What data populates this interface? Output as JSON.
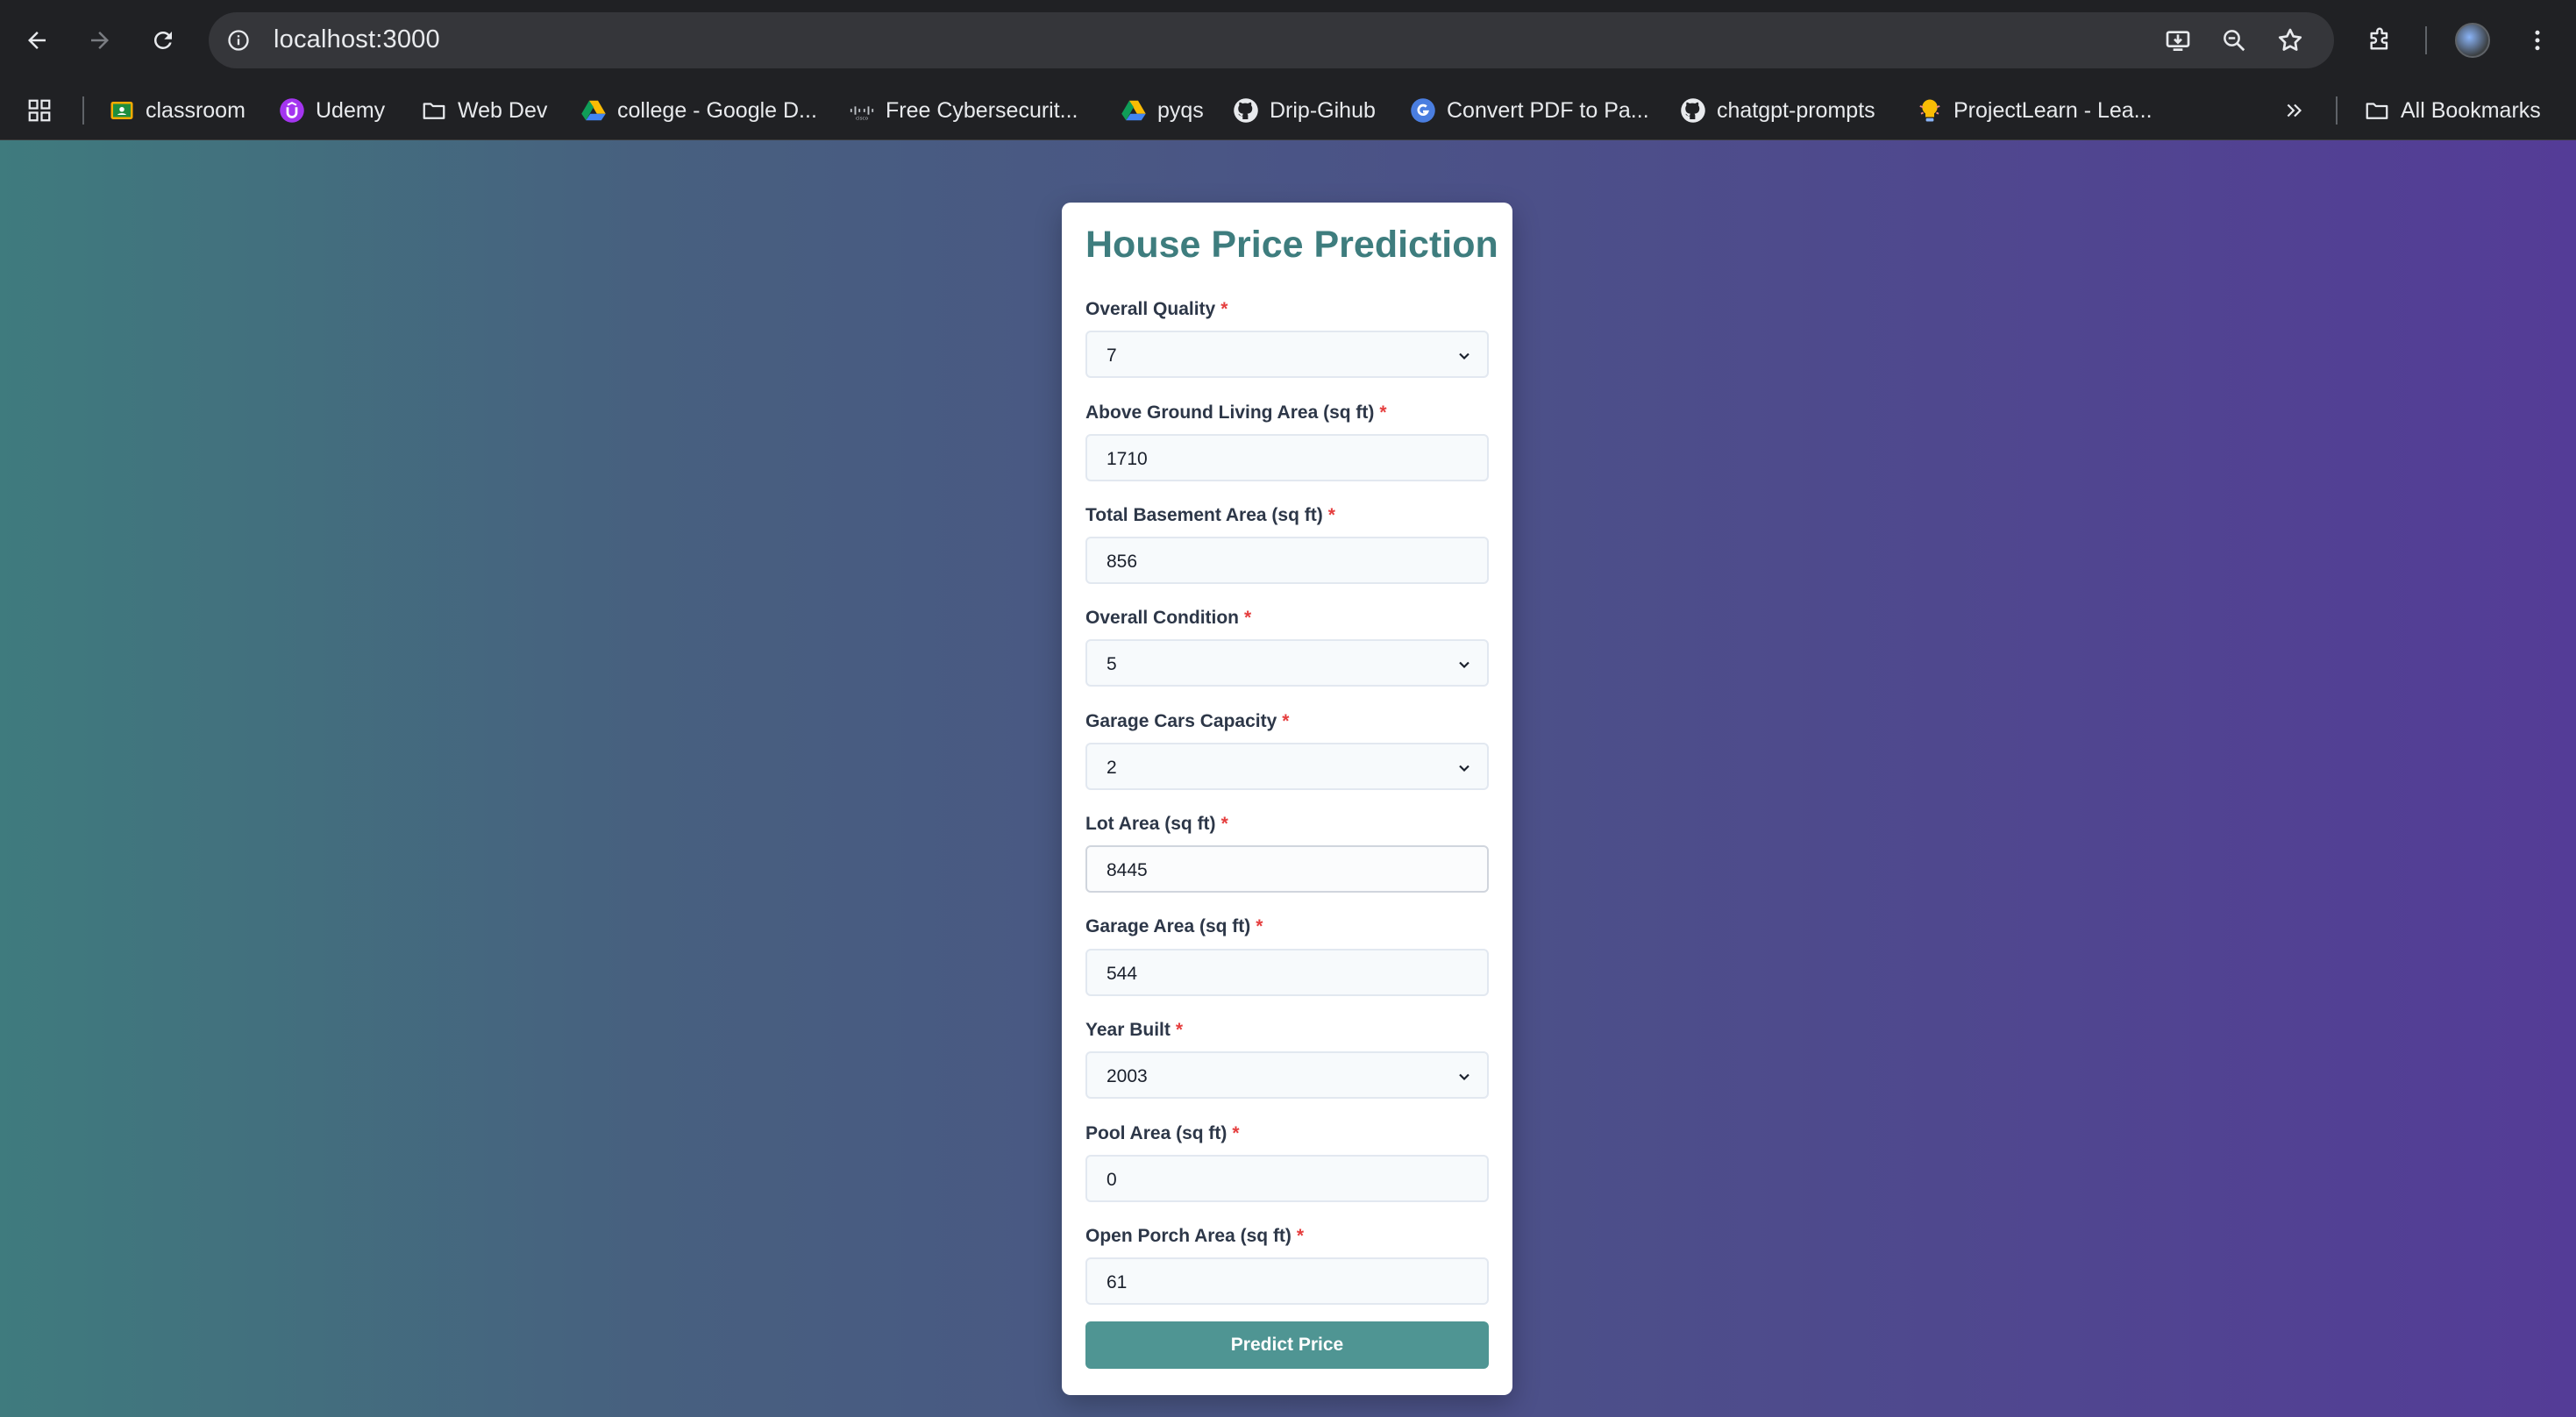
{
  "browser": {
    "url": "localhost:3000",
    "bookmarks": [
      {
        "label": "classroom",
        "icon": "classroom-icon"
      },
      {
        "label": "Udemy",
        "icon": "udemy-icon"
      },
      {
        "label": "Web Dev",
        "icon": "folder-icon"
      },
      {
        "label": "college - Google D...",
        "icon": "google-drive-icon"
      },
      {
        "label": "Free Cybersecurit...",
        "icon": "cisco-icon"
      },
      {
        "label": "pyqs",
        "icon": "google-drive-icon"
      },
      {
        "label": "Drip-Gihub",
        "icon": "github-icon"
      },
      {
        "label": "Convert PDF to Pa...",
        "icon": "convert-icon"
      },
      {
        "label": "chatgpt-prompts",
        "icon": "github-icon"
      },
      {
        "label": "ProjectLearn - Lea...",
        "icon": "projectlearn-icon"
      }
    ],
    "all_bookmarks_label": "All Bookmarks"
  },
  "form": {
    "title": "House Price Prediction",
    "required_marker": "*",
    "fields": [
      {
        "label": "Overall Quality",
        "type": "select",
        "value": "7"
      },
      {
        "label": "Above Ground Living Area (sq ft)",
        "type": "input",
        "value": "1710"
      },
      {
        "label": "Total Basement Area (sq ft)",
        "type": "input",
        "value": "856"
      },
      {
        "label": "Overall Condition",
        "type": "select",
        "value": "5"
      },
      {
        "label": "Garage Cars Capacity",
        "type": "select",
        "value": "2"
      },
      {
        "label": "Lot Area (sq ft)",
        "type": "input",
        "value": "8445"
      },
      {
        "label": "Garage Area (sq ft)",
        "type": "input",
        "value": "544"
      },
      {
        "label": "Year Built",
        "type": "select",
        "value": "2003"
      },
      {
        "label": "Pool Area (sq ft)",
        "type": "input",
        "value": "0"
      },
      {
        "label": "Open Porch Area (sq ft)",
        "type": "input",
        "value": "61"
      }
    ],
    "submit_label": "Predict Price"
  },
  "colors": {
    "title": "#3e7d7e",
    "button": "#4f9593",
    "required": "#e53e3e",
    "gradient_start": "#3f7b7e",
    "gradient_end": "#543c97"
  }
}
